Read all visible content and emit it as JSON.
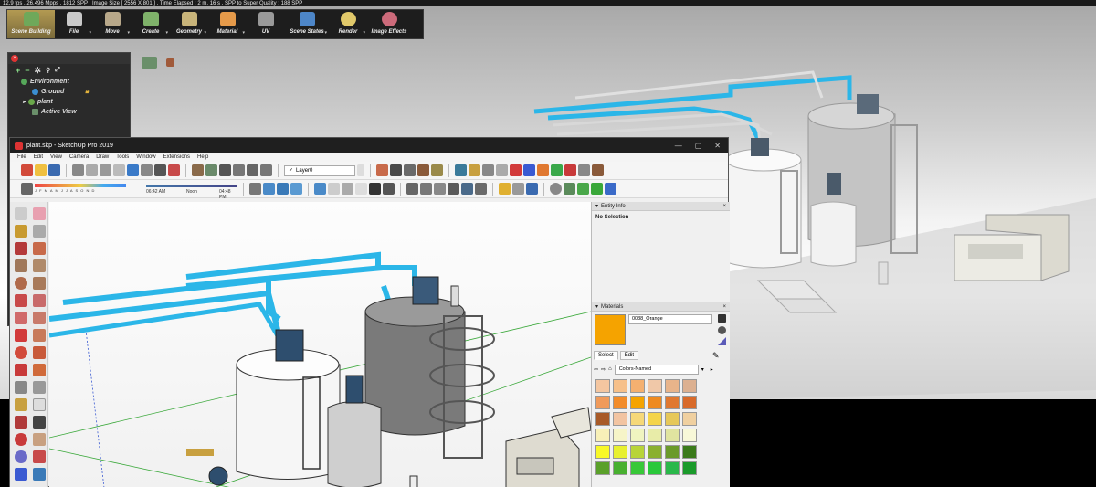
{
  "status_text": "12.9 fps , 26.496 Mpps , 1812 SPP , Image Size [ 2556 X 801 ] , Time Elapsed : 2 m, 16 s , SPP to Super Quality : 188 SPP",
  "top_toolbar": {
    "items": [
      {
        "label": "Scene Building",
        "icon": "scene-building-icon",
        "color": "#6fa85a",
        "active": true
      },
      {
        "label": "File",
        "icon": "file-icon",
        "color": "#c9c9c9"
      },
      {
        "label": "Move",
        "icon": "move-icon",
        "color": "#b8a88a"
      },
      {
        "label": "Create",
        "icon": "create-icon",
        "color": "#7fb26a"
      },
      {
        "label": "Geometry",
        "icon": "geometry-icon",
        "color": "#c8b47a"
      },
      {
        "label": "Material",
        "icon": "material-icon",
        "color": "#e59a4a"
      },
      {
        "label": "UV",
        "icon": "uv-icon",
        "color": "#999999"
      },
      {
        "label": "Scene States",
        "icon": "scene-states-icon",
        "color": "#4d86c8"
      },
      {
        "label": "Render",
        "icon": "render-icon",
        "color": "#e0c86a"
      },
      {
        "label": "Image Effects",
        "icon": "image-effects-icon",
        "color": "#cc6a7a"
      }
    ]
  },
  "scene_panel": {
    "tree": [
      {
        "label": "Environment",
        "level": 0
      },
      {
        "label": "Ground",
        "level": 1,
        "locked": true
      },
      {
        "label": "plant",
        "level": 1
      },
      {
        "label": "Active View",
        "level": 1
      }
    ]
  },
  "sketchup": {
    "title": "plant.skp - SketchUp Pro 2019",
    "menu": [
      "File",
      "Edit",
      "View",
      "Camera",
      "Draw",
      "Tools",
      "Window",
      "Extensions",
      "Help"
    ],
    "layer_selected": "Layer0",
    "shadow_months": "J F M A M J J A S O N D",
    "time_start": "06:42 AM",
    "time_mid": "Noon",
    "time_end": "04:48 PM"
  },
  "tray": {
    "entity_info_title": "Entity Info",
    "entity_info_text": "No Selection",
    "materials_title": "Materials",
    "material_name": "0038_Orange",
    "tab_select": "Select",
    "tab_edit": "Edit",
    "library": "Colors-Named",
    "swatches": [
      "#f4c6a0",
      "#f6c08a",
      "#f4b070",
      "#f0c8a8",
      "#e8b48a",
      "#dcb090",
      "#f09a5a",
      "#f28c2a",
      "#f5a300",
      "#ee8a20",
      "#e07830",
      "#d86a2a",
      "#a85a28",
      "#f2c4a2",
      "#f6d878",
      "#f4d44a",
      "#e6c85a",
      "#f0d0a0",
      "#f8f0b8",
      "#f6f4c8",
      "#f0f4c0",
      "#e8eca8",
      "#e0e4a0",
      "#f8f8d8",
      "#f8f828",
      "#e8f030",
      "#b8d438",
      "#8ab030",
      "#6a9a2a",
      "#3a7a1a",
      "#5aa02a",
      "#48b030",
      "#38c838",
      "#2ac83a",
      "#2ab84a",
      "#1a9a2a"
    ]
  }
}
